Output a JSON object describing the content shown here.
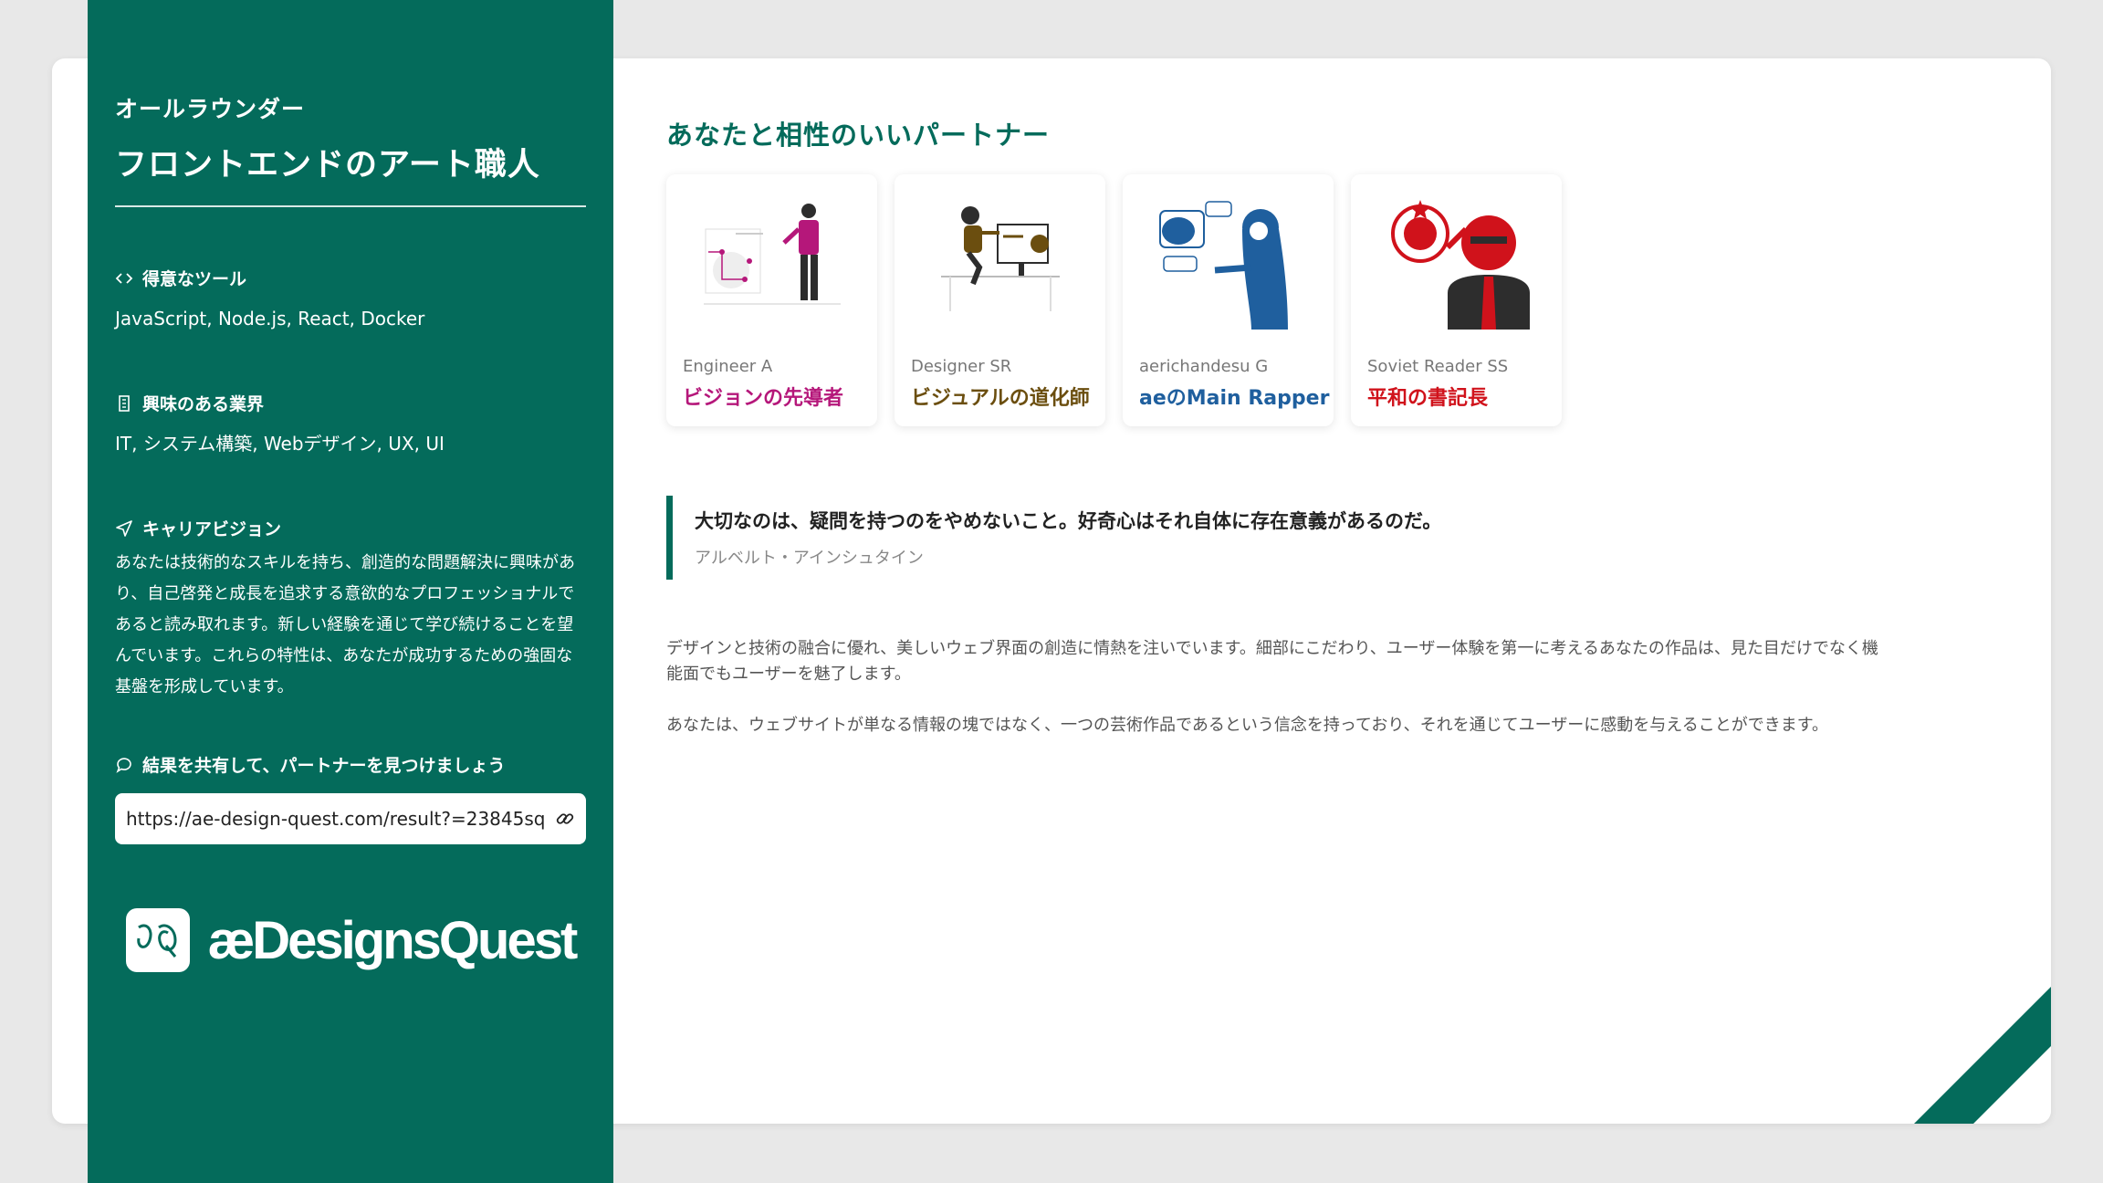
{
  "header": {
    "subtitle": "オールラウンダー",
    "title": "フロントエンドのアート職人"
  },
  "sections": {
    "tools": {
      "heading": "得意なツール",
      "text": "JavaScript, Node.js, React, Docker",
      "icon": "code-icon"
    },
    "industry": {
      "heading": "興味のある業界",
      "text": "IT, システム構築, Webデザイン, UX, UI",
      "icon": "building-icon"
    },
    "vision": {
      "heading": "キャリアビジョン",
      "text": "あなたは技術的なスキルを持ち、創造的な問題解決に興味があり、自己啓発と成長を追求する意欲的なプロフェッショナルであると読み取れます。新しい経験を通じて学び続けることを望んでいます。これらの特性は、あなたが成功するための強固な基盤を形成しています。",
      "icon": "send-icon"
    },
    "share": {
      "heading": "結果を共有して、パートナーを見つけましょう",
      "icon": "chat-icon"
    }
  },
  "share_url": {
    "value": "https://ae-design-quest.com/result?=23845sq"
  },
  "logo": {
    "text": "æDesignsQuest"
  },
  "main": {
    "partners_heading": "あなたと相性のいいパートナー",
    "partners": [
      {
        "name": "Engineer A",
        "title": "ビジョンの先導者",
        "color": "#b5177a"
      },
      {
        "name": "Designer SR",
        "title": "ビジュアルの道化師",
        "color": "#6b4e0f"
      },
      {
        "name": "aerichandesu G",
        "title": "aeのMain Rapper",
        "color": "#1f5f9e"
      },
      {
        "name": "Soviet Reader SS",
        "title": "平和の書記長",
        "color": "#d0121b"
      }
    ],
    "quote": {
      "text": "大切なのは、疑問を持つのをやめないこと。好奇心はそれ自体に存在意義があるのだ。",
      "author": "アルベルト・アインシュタイン"
    },
    "paragraphs": [
      "デザインと技術の融合に優れ、美しいウェブ界面の創造に情熱を注いでいます。細部にこだわり、ユーザー体験を第一に考えるあなたの作品は、見た目だけでなく機能面でもユーザーを魅了します。",
      "あなたは、ウェブサイトが単なる情報の塊ではなく、一つの芸術作品であるという信念を持っており、それを通じてユーザーに感動を与えることができます。"
    ]
  },
  "colors": {
    "brand": "#046b5b",
    "background": "#e8e8e8"
  }
}
